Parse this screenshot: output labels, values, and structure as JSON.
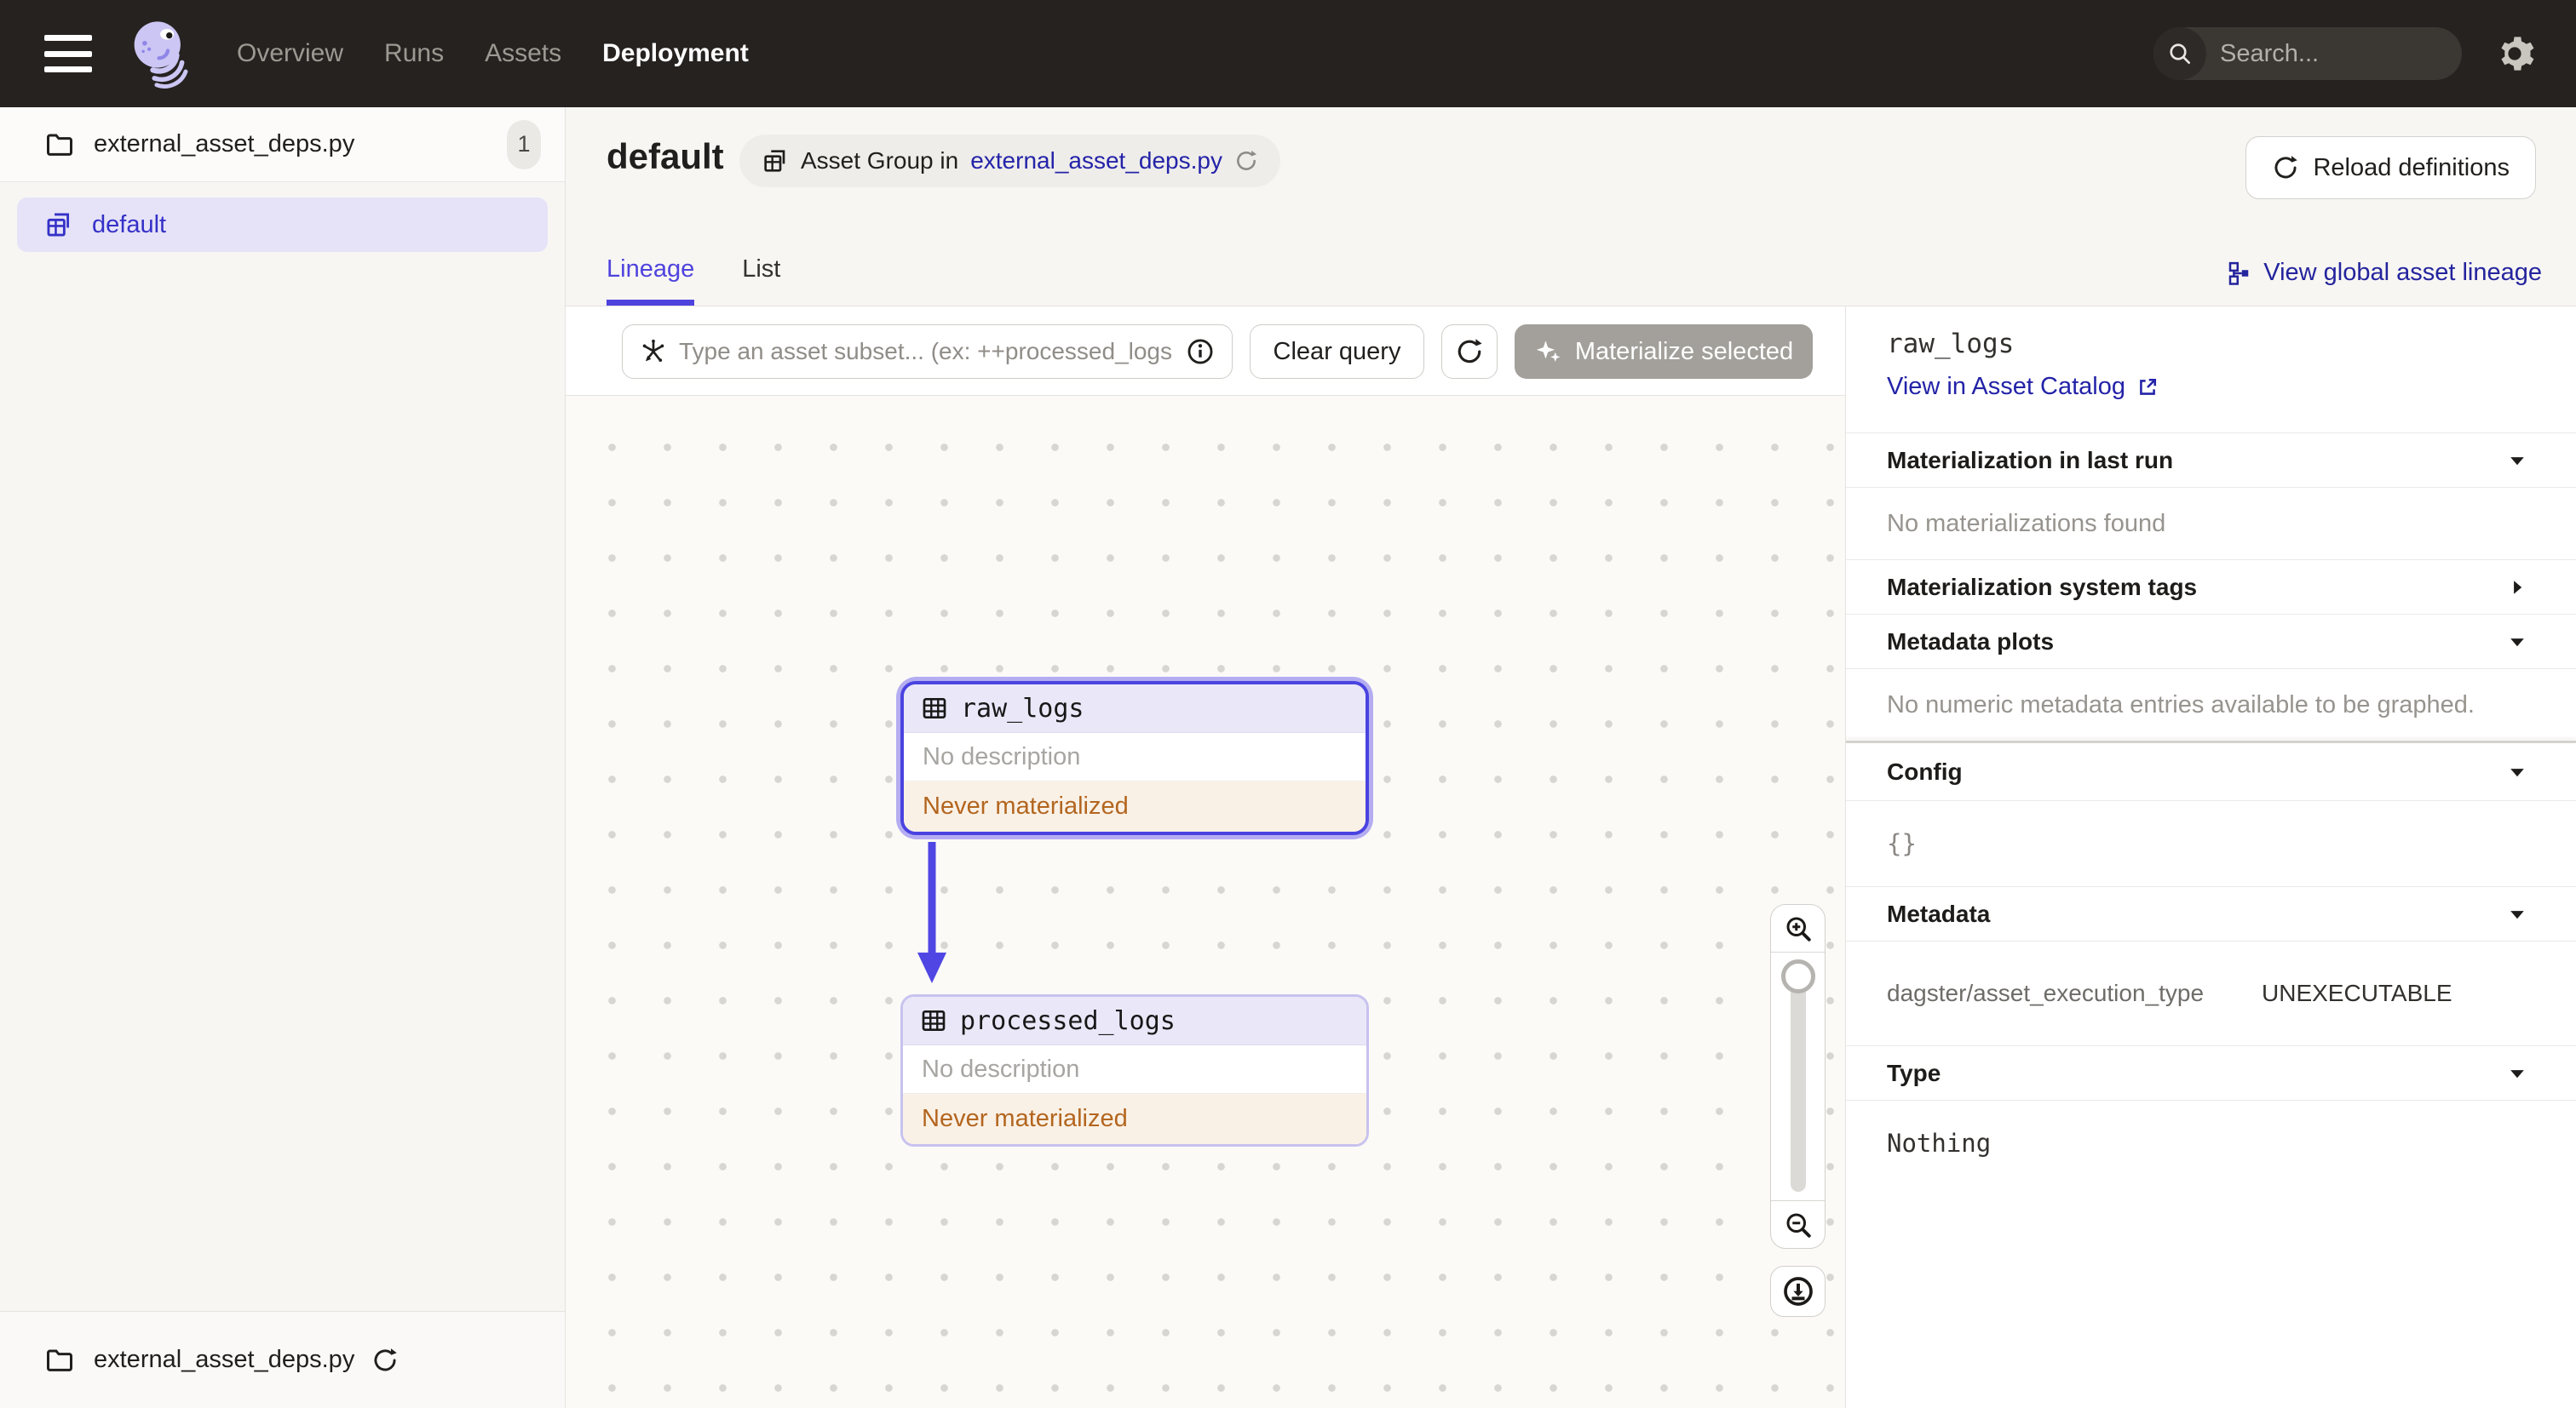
{
  "topnav": {
    "nav_items": [
      {
        "label": "Overview",
        "active": false
      },
      {
        "label": "Runs",
        "active": false
      },
      {
        "label": "Assets",
        "active": false
      },
      {
        "label": "Deployment",
        "active": true
      }
    ],
    "search": {
      "placeholder": "Search...",
      "shortcut": "/"
    }
  },
  "sidebar": {
    "file_label": "external_asset_deps.py",
    "file_count": "1",
    "group_label": "default",
    "footer_label": "external_asset_deps.py"
  },
  "header": {
    "title": "default",
    "badge_prefix": "Asset Group in",
    "badge_link": "external_asset_deps.py",
    "reload_button": "Reload definitions"
  },
  "tabs": {
    "lineage": "Lineage",
    "list": "List",
    "global_lineage_link": "View global asset lineage"
  },
  "toolbar": {
    "query_placeholder": "Type an asset subset... (ex: ++processed_logs",
    "clear_button": "Clear query",
    "materialize_button": "Materialize selected"
  },
  "graph": {
    "nodes": [
      {
        "name": "raw_logs",
        "description": "No description",
        "status": "Never materialized",
        "selected": true
      },
      {
        "name": "processed_logs",
        "description": "No description",
        "status": "Never materialized",
        "selected": false
      }
    ]
  },
  "side_panel": {
    "title": "raw_logs",
    "catalog_link": "View in Asset Catalog",
    "materialization_last_run": {
      "label": "Materialization in last run",
      "empty": "No materializations found"
    },
    "system_tags": {
      "label": "Materialization system tags"
    },
    "metadata_plots": {
      "label": "Metadata plots",
      "empty": "No numeric metadata entries available to be graphed."
    },
    "config": {
      "label": "Config",
      "value": "{}"
    },
    "metadata": {
      "label": "Metadata",
      "rows": [
        {
          "key": "dagster/asset_execution_type",
          "value": "UNEXECUTABLE"
        }
      ]
    },
    "type": {
      "label": "Type",
      "value": "Nothing"
    }
  },
  "colors": {
    "accent": "#4F43DD",
    "link": "#2423A8",
    "warning_text": "#B3661F",
    "warning_bg": "#FAF1E6",
    "selected_node_border": "#4A43E0",
    "edge": "#5046E4",
    "topnav_bg": "#262220"
  }
}
